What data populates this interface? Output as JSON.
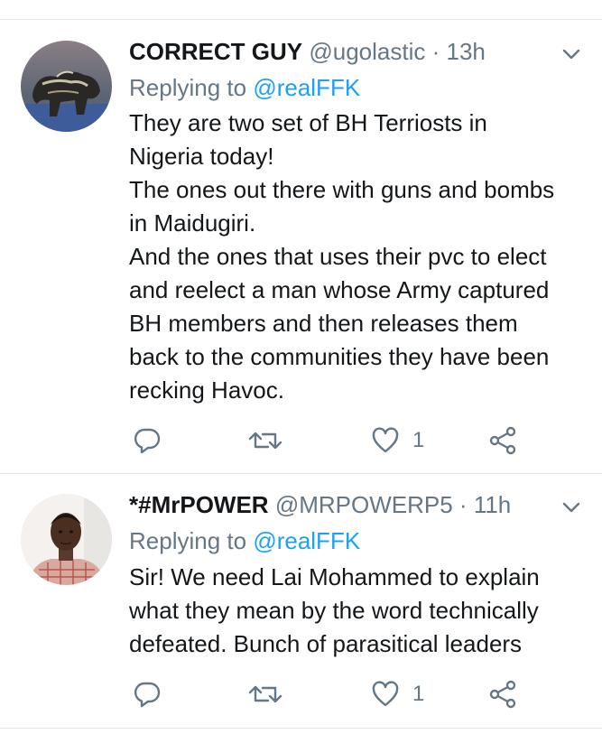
{
  "tweets": [
    {
      "display_name": "CORRECT GUY",
      "handle": "@ugolastic",
      "separator": "·",
      "time": "13h",
      "replying_prefix": "Replying to",
      "replying_to": "@realFFK",
      "text_lines": [
        "They are two set of BH Terriosts in",
        "Nigeria today!",
        "The ones out there with guns and bombs",
        "in Maidugiri.",
        "And the ones that uses their pvc to elect",
        "and reelect a man whose Army captured",
        "BH members and then releases them",
        "back to the communities they have been",
        "recking Havoc."
      ],
      "like_count": "1"
    },
    {
      "display_name": "*#MrPOWER",
      "handle": "@MRPOWERP5",
      "separator": "·",
      "time": "11h",
      "replying_prefix": "Replying to",
      "replying_to": "@realFFK",
      "text_lines": [
        "Sir! We need Lai Mohammed to explain",
        "what they mean by the word technically",
        "defeated. Bunch of parasitical leaders"
      ],
      "like_count": "1"
    }
  ],
  "colors": {
    "text_primary": "#14171a",
    "text_secondary": "#657786",
    "link": "#1da1f2",
    "divider": "#e3e7eb"
  },
  "icons": [
    "chevron-down-icon",
    "reply-icon",
    "retweet-icon",
    "like-icon",
    "share-icon"
  ]
}
